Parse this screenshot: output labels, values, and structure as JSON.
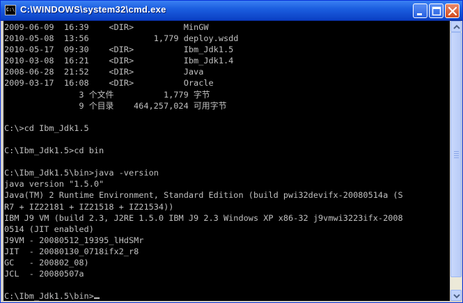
{
  "window": {
    "title": "C:\\WINDOWS\\system32\\cmd.exe",
    "icon_label": "C:\\",
    "icon_name": "cmd-icon"
  },
  "controls": {
    "minimize_icon": "minimize-icon",
    "maximize_icon": "maximize-icon",
    "close_icon": "close-icon"
  },
  "console": {
    "lines": [
      "2009-06-09  16:39    <DIR>          MinGW",
      "2010-05-08  13:56             1,779 deploy.wsdd",
      "2010-05-17  09:30    <DIR>          Ibm_Jdk1.5",
      "2010-03-08  16:21    <DIR>          Ibm_Jdk1.4",
      "2008-06-28  21:52    <DIR>          Java",
      "2009-03-17  16:08    <DIR>          Oracle",
      "               3 个文件          1,779 字节",
      "               9 个目录    464,257,024 可用字节",
      "",
      "C:\\>cd Ibm_Jdk1.5",
      "",
      "C:\\Ibm_Jdk1.5>cd bin",
      "",
      "C:\\Ibm_Jdk1.5\\bin>java -version",
      "java version \"1.5.0\"",
      "Java(TM) 2 Runtime Environment, Standard Edition (build pwi32devifx-20080514a (S",
      "R7 + IZ22181 + IZ21518 + IZ21534))",
      "IBM J9 VM (build 2.3, J2RE 1.5.0 IBM J9 2.3 Windows XP x86-32 j9vmwi3223ifx-2008",
      "0514 (JIT enabled)",
      "J9VM - 20080512_19395_lHdSMr",
      "JIT  - 20080130_0718ifx2_r8",
      "GC   - 200802_08)",
      "JCL  - 20080507a",
      ""
    ],
    "prompt": "C:\\Ibm_Jdk1.5\\bin>"
  }
}
